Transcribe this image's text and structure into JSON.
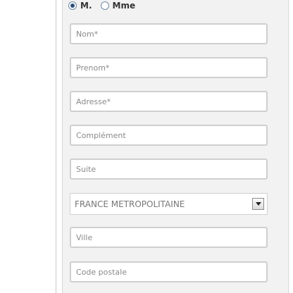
{
  "civility": {
    "options": [
      {
        "label": "M.",
        "selected": true
      },
      {
        "label": "Mme",
        "selected": false
      }
    ]
  },
  "form": {
    "nom_placeholder": "Nom*",
    "prenom_placeholder": "Prenom*",
    "adresse_placeholder": "Adresse*",
    "complement_placeholder": "Complément",
    "suite_placeholder": "Suite",
    "country_selected": "FRANCE METROPOLITAINE",
    "ville_placeholder": "Ville",
    "code_postal_placeholder": "Code postale"
  },
  "icons": {
    "select_arrow": "chevron-down-icon"
  },
  "colors": {
    "panel_background": "#f2f2f2",
    "field_border": "#cfcfcf",
    "radio_selected": "#2b4f7a"
  }
}
